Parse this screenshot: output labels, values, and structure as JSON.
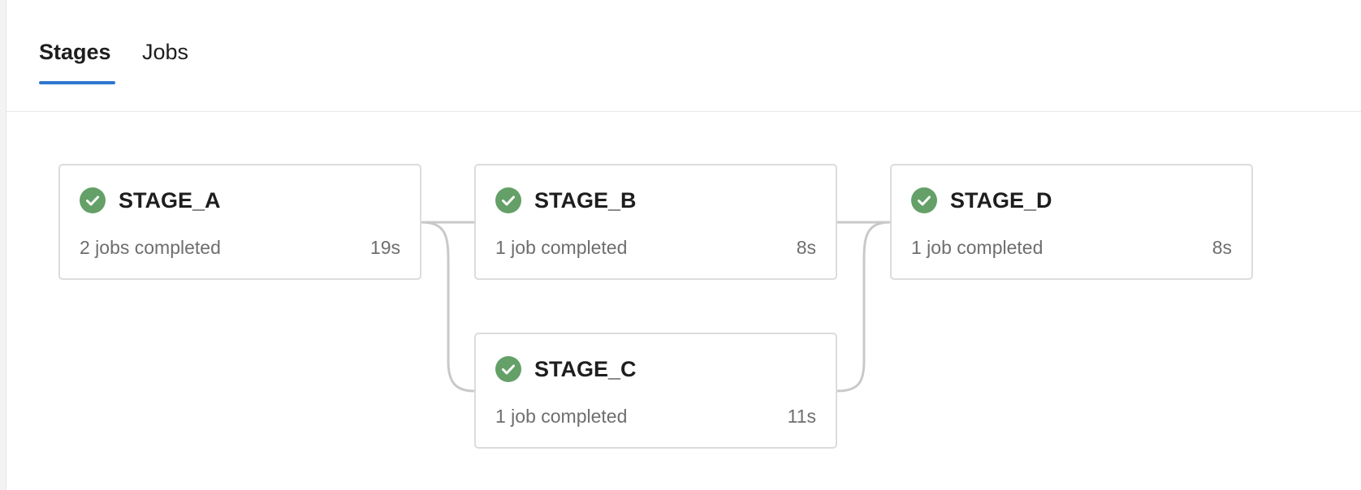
{
  "tabs": [
    {
      "label": "Stages",
      "active": true
    },
    {
      "label": "Jobs",
      "active": false
    }
  ],
  "colors": {
    "accent": "#2f77d0",
    "success": "#64a067",
    "connector": "#c9c9c9"
  },
  "stages": [
    {
      "name": "STAGE_A",
      "jobs": "2 jobs completed",
      "duration": "19s",
      "status": "success",
      "icon": "check-circle-icon"
    },
    {
      "name": "STAGE_B",
      "jobs": "1 job completed",
      "duration": "8s",
      "status": "success",
      "icon": "check-circle-icon"
    },
    {
      "name": "STAGE_C",
      "jobs": "1 job completed",
      "duration": "11s",
      "status": "success",
      "icon": "check-circle-icon"
    },
    {
      "name": "STAGE_D",
      "jobs": "1 job completed",
      "duration": "8s",
      "status": "success",
      "icon": "check-circle-icon"
    }
  ]
}
